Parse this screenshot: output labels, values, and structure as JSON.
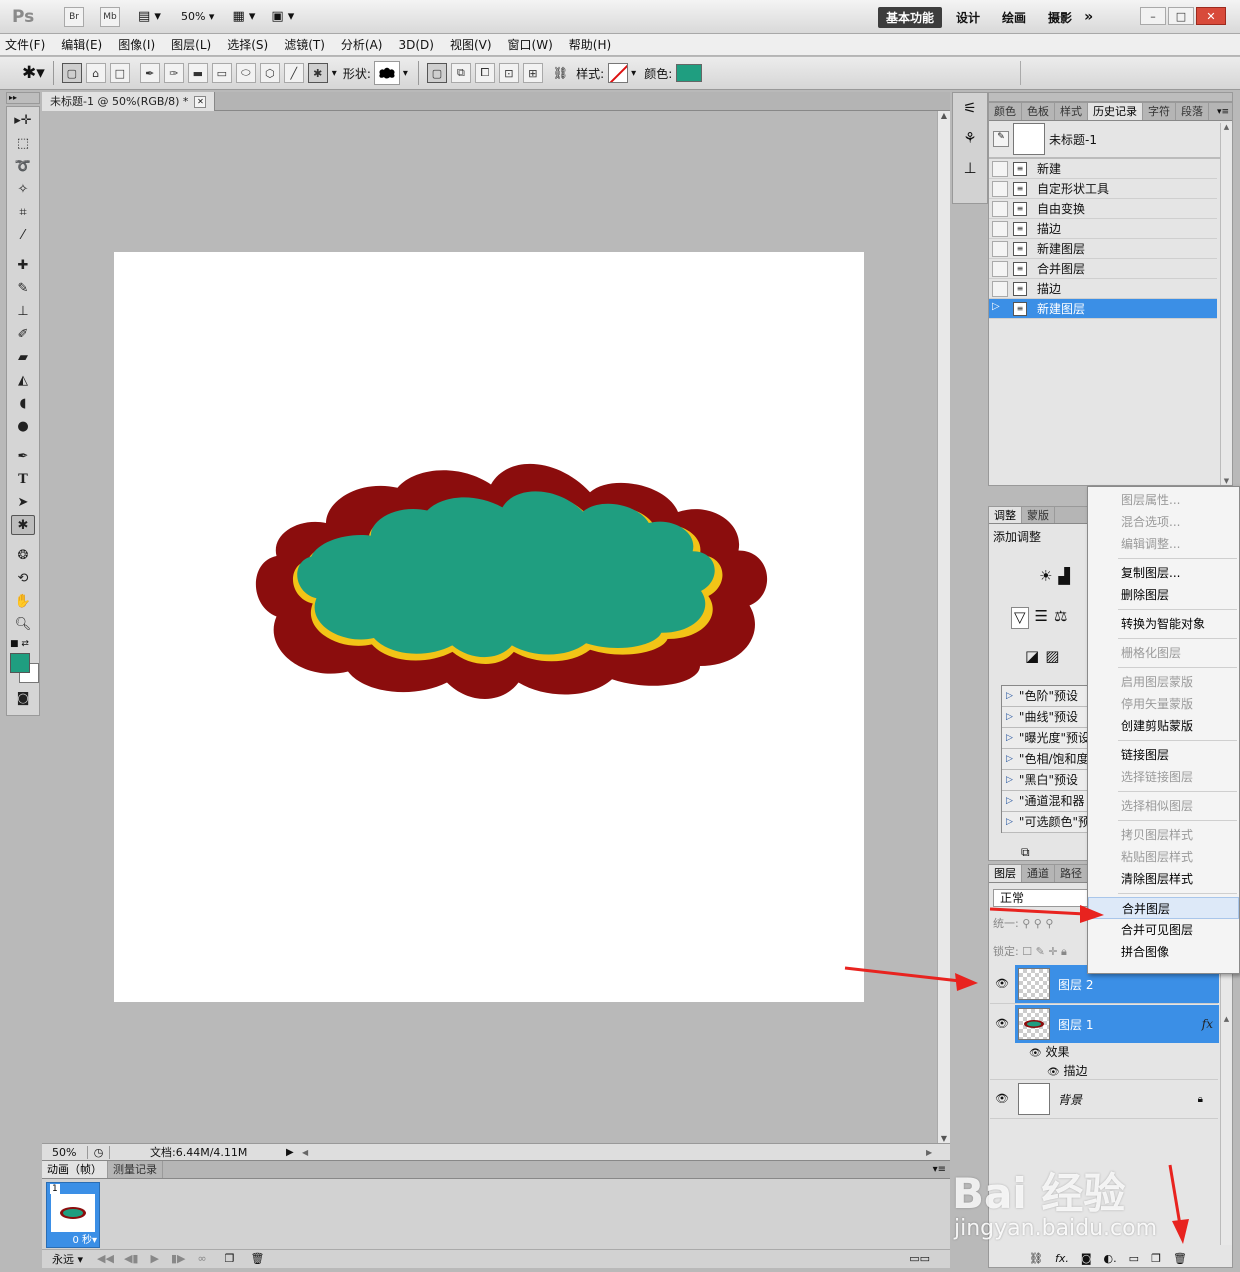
{
  "app": {
    "logo": "Ps",
    "zoom": "50%",
    "br_label": "Br",
    "mb_label": "Mb"
  },
  "workspaces": [
    "基本功能",
    "设计",
    "绘画",
    "摄影"
  ],
  "workspace_more": "»",
  "window_buttons": {
    "minimize": "–",
    "restore": "□",
    "close": "✕"
  },
  "menu": [
    "文件(F)",
    "编辑(E)",
    "图像(I)",
    "图层(L)",
    "选择(S)",
    "滤镜(T)",
    "分析(A)",
    "3D(D)",
    "视图(V)",
    "窗口(W)",
    "帮助(H)"
  ],
  "options": {
    "shape_label": "形状:",
    "style_label": "样式:",
    "color_label": "颜色:",
    "color": "#1f9e80"
  },
  "document": {
    "tab_title": "未标题-1 @ 50%(RGB/8) *",
    "close": "✕"
  },
  "shape": {
    "fill": "#1f9e80",
    "inner_stroke": "#f2c417",
    "outer_stroke": "#8b0d0d"
  },
  "status": {
    "zoom": "50%",
    "doc_info": "文档:6.44M/4.11M"
  },
  "animation": {
    "tabs": [
      "动画（帧）",
      "测量记录"
    ],
    "frame_number": "1",
    "frame_delay": "0 秒▾",
    "loop": "永远"
  },
  "history": {
    "tabs": [
      "颜色",
      "色板",
      "样式",
      "历史记录",
      "字符",
      "段落"
    ],
    "snapshot": "未标题-1",
    "steps": [
      "新建",
      "自定形状工具",
      "自由变换",
      "描边",
      "新建图层",
      "合并图层",
      "描边",
      "新建图层"
    ],
    "selected_index": 7
  },
  "adjustments": {
    "tabs": [
      "调整",
      "蒙版"
    ],
    "title": "添加调整",
    "presets": [
      "\"色阶\"预设",
      "\"曲线\"预设",
      "\"曝光度\"预设",
      "\"色相/饱和度",
      "\"黑白\"预设",
      "\"通道混和器",
      "\"可选颜色\"预"
    ]
  },
  "layers": {
    "tabs": [
      "图层",
      "通道",
      "路径"
    ],
    "blend_mode": "正常",
    "unify_label": "统一:",
    "lock_label": "锁定:",
    "items": [
      {
        "name": "图层 2",
        "selected": true
      },
      {
        "name": "图层 1",
        "selected": true,
        "fx": "fx"
      },
      {
        "name": "背景",
        "selected": false
      }
    ],
    "effects_label": "效果",
    "stroke_label": "描边"
  },
  "context_menu": {
    "groups": [
      [
        {
          "label": "图层属性...",
          "disabled": true
        },
        {
          "label": "混合选项...",
          "disabled": true
        },
        {
          "label": "编辑调整...",
          "disabled": true
        }
      ],
      [
        {
          "label": "复制图层...",
          "disabled": false
        },
        {
          "label": "删除图层",
          "disabled": false
        }
      ],
      [
        {
          "label": "转换为智能对象",
          "disabled": false
        }
      ],
      [
        {
          "label": "栅格化图层",
          "disabled": true
        }
      ],
      [
        {
          "label": "启用图层蒙版",
          "disabled": true
        },
        {
          "label": "停用矢量蒙版",
          "disabled": true
        },
        {
          "label": "创建剪贴蒙版",
          "disabled": false
        }
      ],
      [
        {
          "label": "链接图层",
          "disabled": false
        },
        {
          "label": "选择链接图层",
          "disabled": true
        }
      ],
      [
        {
          "label": "选择相似图层",
          "disabled": true
        }
      ],
      [
        {
          "label": "拷贝图层样式",
          "disabled": true
        },
        {
          "label": "粘贴图层样式",
          "disabled": true
        },
        {
          "label": "清除图层样式",
          "disabled": false
        }
      ],
      [
        {
          "label": "合并图层",
          "disabled": false,
          "highlighted": true
        },
        {
          "label": "合并可见图层",
          "disabled": false
        },
        {
          "label": "拼合图像",
          "disabled": false
        }
      ]
    ]
  },
  "watermark": {
    "brand": "Bai 经验",
    "url": "jingyan.baidu.com"
  },
  "annotation_color": "#e8231f"
}
